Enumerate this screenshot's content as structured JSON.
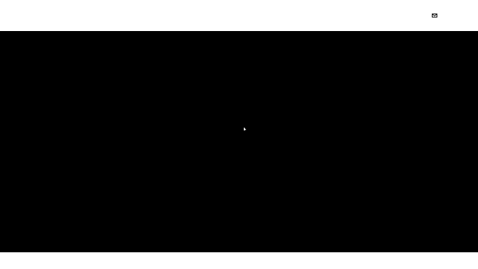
{
  "header": {
    "mail_icon": "mail-icon"
  },
  "stage": {
    "background_color": "#000000",
    "pointer_icon": "mouse-pointer-icon"
  },
  "colors": {
    "page_background": "#ffffff",
    "icon_color": "#222222"
  }
}
